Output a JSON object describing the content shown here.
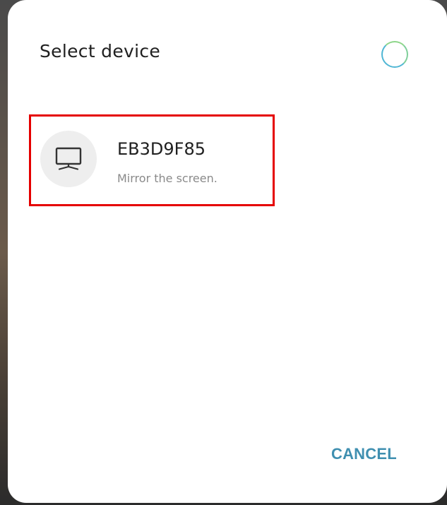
{
  "dialog": {
    "title": "Select device",
    "spinner_icon": "loading-spinner-icon",
    "devices": [
      {
        "name": "EB3D9F85",
        "description": "Mirror the screen.",
        "icon": "tv-monitor-icon"
      }
    ],
    "cancel_label": "CANCEL"
  },
  "colors": {
    "accent": "#3f8fb0",
    "highlight_border": "#e50000",
    "avatar_bg": "#eeeeee",
    "title_text": "#202020",
    "secondary_text": "#8a8a8a"
  }
}
